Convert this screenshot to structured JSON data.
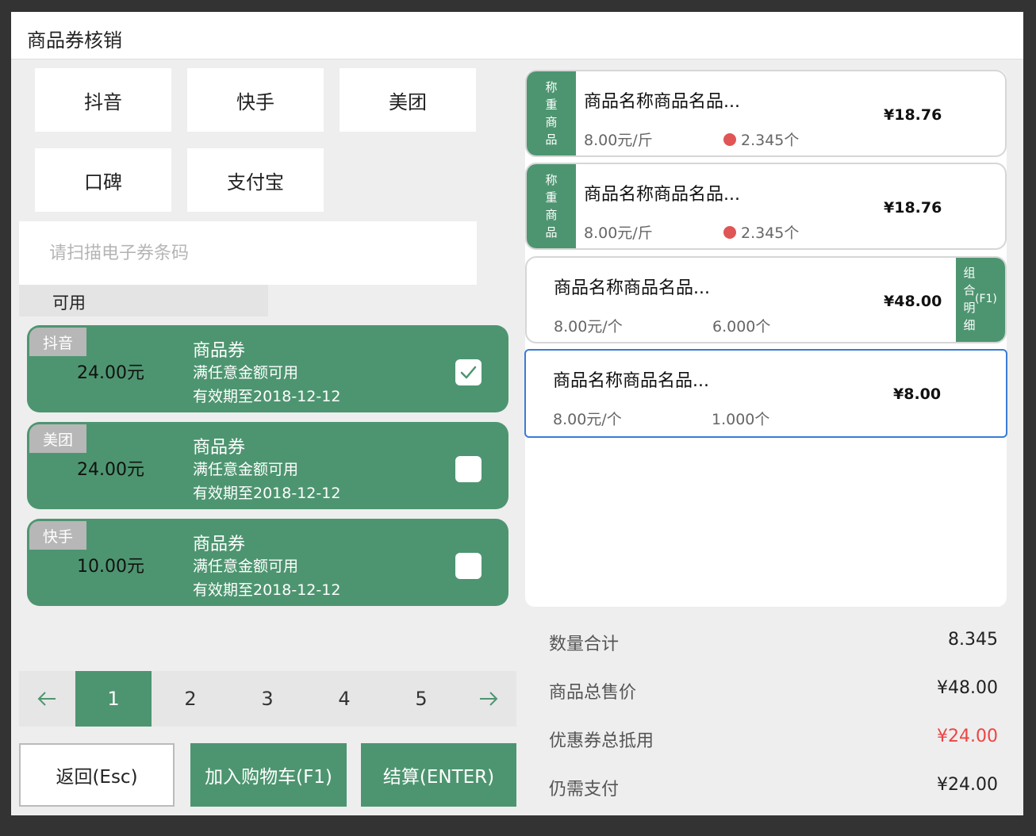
{
  "window": {
    "title": "商品券核销"
  },
  "platforms": [
    "抖音",
    "快手",
    "美团",
    "口碑",
    "支付宝"
  ],
  "scan": {
    "placeholder": "请扫描电子券条码",
    "value": ""
  },
  "filter_tab": "可用",
  "coupons": [
    {
      "platform": "抖音",
      "amount": "24.00元",
      "title": "商品券",
      "condition": "满任意金额可用",
      "expiry": "有效期至2018-12-12",
      "checked": true
    },
    {
      "platform": "美团",
      "amount": "24.00元",
      "title": "商品券",
      "condition": "满任意金额可用",
      "expiry": "有效期至2018-12-12",
      "checked": false
    },
    {
      "platform": "快手",
      "amount": "10.00元",
      "title": "商品券",
      "condition": "满任意金额可用",
      "expiry": "有效期至2018-12-12",
      "checked": false
    }
  ],
  "pagination": {
    "prev": "←",
    "next": "→",
    "pages": [
      "1",
      "2",
      "3",
      "4",
      "5"
    ],
    "current": 1
  },
  "buttons": {
    "back": "返回(Esc)",
    "add_cart": "加入购物车(F1)",
    "checkout": "结算(ENTER)"
  },
  "products": [
    {
      "tag": [
        "称",
        "重",
        "商",
        "品"
      ],
      "name": "商品名称商品名品...",
      "unit_price": "8.00元/斤",
      "qty": "2.345个",
      "total": "¥18.76",
      "weighed": true
    },
    {
      "tag": [
        "称",
        "重",
        "商",
        "品"
      ],
      "name": "商品名称商品名品...",
      "unit_price": "8.00元/斤",
      "qty": "2.345个",
      "total": "¥18.76",
      "weighed": true
    },
    {
      "name": "商品名称商品名品...",
      "unit_price": "8.00元/个",
      "qty": "6.000个",
      "total": "¥48.00",
      "combo_tag": [
        "组",
        "合",
        "明",
        "细"
      ],
      "combo_key": "(F1)"
    },
    {
      "name": "商品名称商品名品...",
      "unit_price": "8.00元/个",
      "qty": "1.000个",
      "total": "¥8.00",
      "selected": true
    }
  ],
  "summary": [
    {
      "label": "数量合计",
      "value": "8.345"
    },
    {
      "label": "商品总售价",
      "value": "¥48.00"
    },
    {
      "label": "优惠券总抵用",
      "value": "¥24.00",
      "highlight": "#ee4444"
    },
    {
      "label": "仍需支付",
      "value": "¥24.00"
    }
  ],
  "colors": {
    "accent": "#4d9570",
    "selection": "#3a7bd5",
    "warning": "#e05555",
    "discount": "#ee4444"
  }
}
